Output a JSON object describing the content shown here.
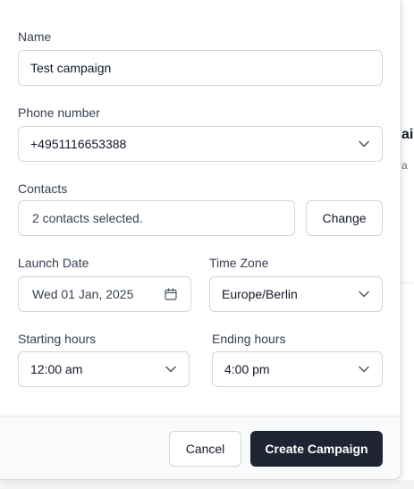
{
  "background": {
    "peek_title": "aig",
    "peek_subtitle": "a"
  },
  "form": {
    "name": {
      "label": "Name",
      "value": "Test campaign"
    },
    "phone": {
      "label": "Phone number",
      "value": "+4951116653388"
    },
    "contacts": {
      "label": "Contacts",
      "value": "2 contacts selected.",
      "change_label": "Change"
    },
    "launch_date": {
      "label": "Launch Date",
      "value": "Wed 01 Jan, 2025"
    },
    "time_zone": {
      "label": "Time Zone",
      "value": "Europe/Berlin"
    },
    "starting_hours": {
      "label": "Starting hours",
      "value": "12:00 am"
    },
    "ending_hours": {
      "label": "Ending hours",
      "value": "4:00 pm"
    }
  },
  "footer": {
    "cancel_label": "Cancel",
    "create_label": "Create Campaign"
  },
  "icons": {
    "select": "chevron-down-icon",
    "date": "calendar-icon"
  },
  "colors": {
    "primary_button": "#1f2432",
    "border": "#d1d5db",
    "label": "#374151",
    "text": "#111827"
  }
}
